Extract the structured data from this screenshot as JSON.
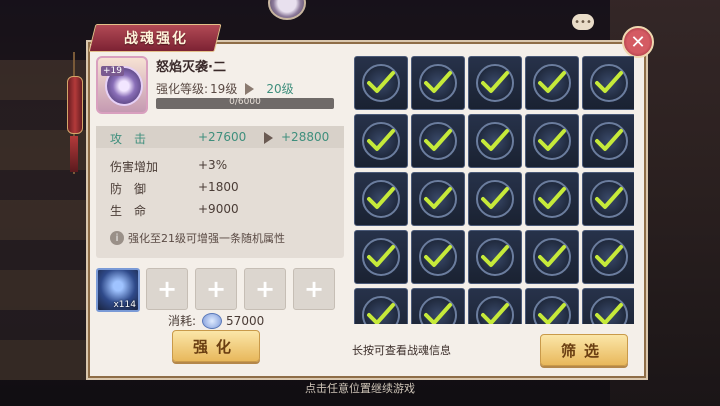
{
  "dialog": {
    "title": "战魂强化",
    "close_glyph": "✕"
  },
  "item": {
    "plus_badge": "+19",
    "name": "怒焰灭袭·二",
    "level_label": "强化等级:",
    "level_from": "19级",
    "level_to": "20级",
    "progress_text": "0/6000",
    "progress_fraction": 0
  },
  "stats": {
    "main": {
      "label": "攻　击",
      "value": "+27600",
      "next": "+28800"
    },
    "rows": [
      {
        "label": "伤害增加",
        "value": "+3%"
      },
      {
        "label": "防　御",
        "value": "+1800"
      },
      {
        "label": "生　命",
        "value": "+9000"
      }
    ],
    "hint": "强化至21级可增强一条随机属性",
    "hint_icon": "i"
  },
  "materials": {
    "filled_count": "x114",
    "empty_plus": "+"
  },
  "cost": {
    "label": "消耗:",
    "value": "57000"
  },
  "buttons": {
    "enhance": "强化",
    "filter": "筛选"
  },
  "grid": {
    "rows": 5,
    "cols": 5,
    "checkmark_color": "#c6ea3a"
  },
  "footer_hint": "长按可查看战魂信息",
  "bottom_hint": "点击任意位置继续游戏",
  "chat_glyph": "•••"
}
